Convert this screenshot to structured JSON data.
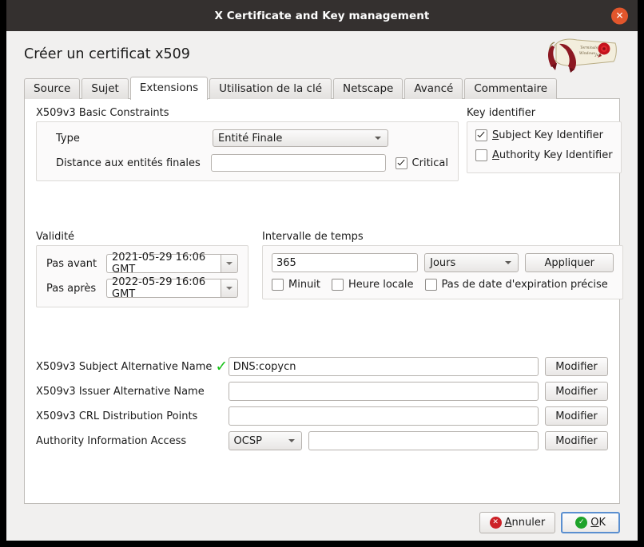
{
  "window": {
    "title": "X Certificate and Key management",
    "close_label": "✕"
  },
  "heading": "Créer un certificat x509",
  "logo": {
    "name": "certificate-scroll-logo"
  },
  "tabs": [
    {
      "label": "Source",
      "active": false
    },
    {
      "label": "Sujet",
      "active": false
    },
    {
      "label": "Extensions",
      "active": true
    },
    {
      "label": "Utilisation de la clé",
      "active": false
    },
    {
      "label": "Netscape",
      "active": false
    },
    {
      "label": "Avancé",
      "active": false
    },
    {
      "label": "Commentaire",
      "active": false
    }
  ],
  "basic_constraints": {
    "group_label": "X509v3 Basic Constraints",
    "type_label": "Type",
    "type_value": "Entité Finale",
    "pathlen_label": "Distance aux entités finales",
    "pathlen_value": "",
    "critical_label": "Critical",
    "critical_checked": true
  },
  "key_identifier": {
    "group_label": "Key identifier",
    "subject_key_identifier_label": "Subject Key Identifier",
    "subject_key_identifier_checked": true,
    "authority_key_identifier_label": "Authority Key Identifier",
    "authority_key_identifier_checked": false
  },
  "validity": {
    "group_label": "Validité",
    "not_before_label": "Pas avant",
    "not_before_value": "2021-05-29 16:06 GMT",
    "not_after_label": "Pas après",
    "not_after_value": "2022-05-29 16:06 GMT"
  },
  "time_range": {
    "group_label": "Intervalle de temps",
    "amount_value": "365",
    "unit_value": "Jours",
    "apply_label": "Appliquer",
    "midnight_label": "Minuit",
    "midnight_checked": false,
    "local_time_label": "Heure locale",
    "local_time_checked": false,
    "no_well_defined_expiration_label": "Pas de date d'expiration précise",
    "no_well_defined_expiration_checked": false
  },
  "extensions_rows": [
    {
      "label": "X509v3 Subject Alternative Name",
      "has_check": true,
      "value": "DNS:copycn",
      "button": "Modifier"
    },
    {
      "label": "X509v3 Issuer Alternative Name",
      "has_check": false,
      "value": "",
      "button": "Modifier"
    },
    {
      "label": "X509v3 CRL Distribution Points",
      "has_check": false,
      "value": "",
      "button": "Modifier"
    }
  ],
  "authority_info_access": {
    "label": "Authority Information Access",
    "method_value": "OCSP",
    "value": "",
    "button": "Modifier"
  },
  "footer": {
    "cancel_label": "Annuler",
    "ok_label": "OK",
    "cancel_icon": "✕",
    "ok_icon": "✓"
  },
  "colors": {
    "titlebar": "#34302f",
    "close": "#e2562c",
    "accent_check": "#19c21a",
    "default_button_border": "#5a8fd0",
    "cancel_icon_bg": "#cc2127",
    "ok_icon_bg": "#1ea32a"
  }
}
